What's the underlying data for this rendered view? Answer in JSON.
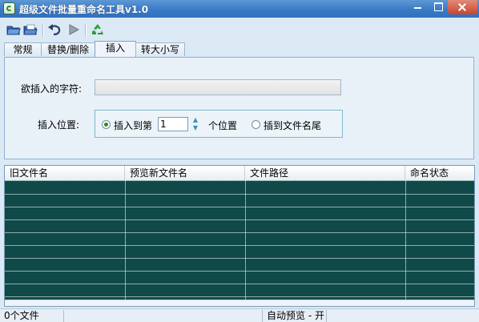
{
  "window": {
    "title": "超级文件批量重命名工具v1.0"
  },
  "toolbar": {
    "icons": [
      "open-file-icon",
      "open-folder-icon",
      "undo-icon",
      "run-icon",
      "recycle-icon"
    ]
  },
  "tabs": [
    {
      "label": "常规",
      "active": false
    },
    {
      "label": "替换/删除",
      "active": false
    },
    {
      "label": "插入",
      "active": true
    },
    {
      "label": "转大小写",
      "active": false
    }
  ],
  "insert_panel": {
    "chars_label": "欲插入的字符:",
    "chars_value": "",
    "position_label": "插入位置:",
    "option_at_position_label": "插入到第",
    "position_value": "1",
    "position_suffix": "个位置",
    "option_end_label": "插到文件名尾",
    "selected_option": "插入到第"
  },
  "file_table": {
    "columns": [
      "旧文件名",
      "预览新文件名",
      "文件路径",
      "命名状态"
    ],
    "rows": []
  },
  "statusbar": {
    "file_count": "0个文件",
    "preview_status": "自动预览 - 开"
  },
  "colors": {
    "titlebar": "#3a7bc8",
    "table_background": "#0f4a48",
    "window_background": "#dbe9f5"
  }
}
